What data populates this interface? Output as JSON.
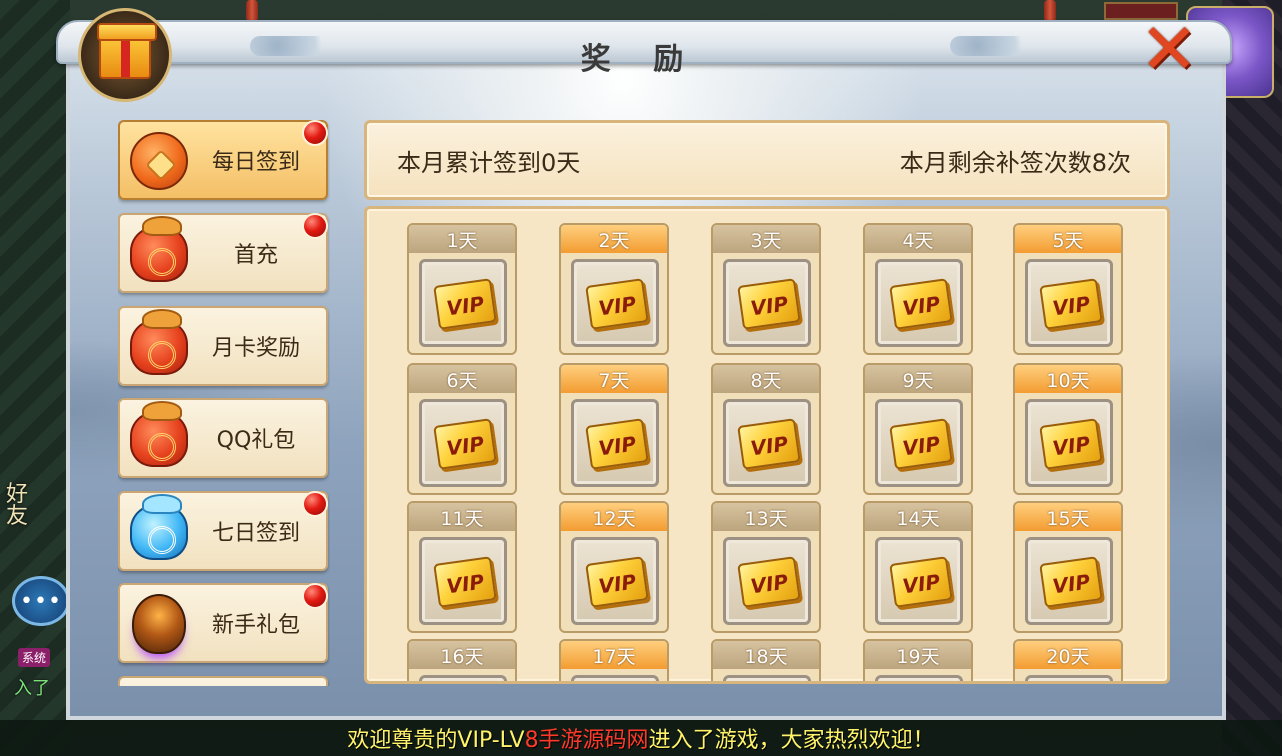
{
  "window": {
    "title": "奖 励",
    "close_symbol": "✕"
  },
  "menu": {
    "items": [
      {
        "label": "每日签到",
        "icon": "pouch-icon",
        "active": true,
        "badge": true
      },
      {
        "label": "首充",
        "icon": "red-bag-icon",
        "active": false,
        "badge": true
      },
      {
        "label": "月卡奖励",
        "icon": "red-bag-icon",
        "active": false,
        "badge": false
      },
      {
        "label": "QQ礼包",
        "icon": "red-bag-icon",
        "active": false,
        "badge": false
      },
      {
        "label": "七日签到",
        "icon": "blue-bag-icon",
        "active": false,
        "badge": true
      },
      {
        "label": "新手礼包",
        "icon": "flame-icon",
        "active": false,
        "badge": true
      }
    ]
  },
  "summary": {
    "signed_days_text": "本月累计签到0天",
    "remaining_makeup_text": "本月剩余补签次数8次"
  },
  "days": [
    {
      "label": "1天",
      "color": "grey"
    },
    {
      "label": "2天",
      "color": "orange"
    },
    {
      "label": "3天",
      "color": "grey"
    },
    {
      "label": "4天",
      "color": "grey"
    },
    {
      "label": "5天",
      "color": "orange"
    },
    {
      "label": "6天",
      "color": "grey"
    },
    {
      "label": "7天",
      "color": "orange"
    },
    {
      "label": "8天",
      "color": "grey"
    },
    {
      "label": "9天",
      "color": "grey"
    },
    {
      "label": "10天",
      "color": "orange"
    },
    {
      "label": "11天",
      "color": "grey"
    },
    {
      "label": "12天",
      "color": "orange"
    },
    {
      "label": "13天",
      "color": "grey"
    },
    {
      "label": "14天",
      "color": "grey"
    },
    {
      "label": "15天",
      "color": "orange"
    },
    {
      "label": "16天",
      "color": "grey"
    },
    {
      "label": "17天",
      "color": "orange"
    },
    {
      "label": "18天",
      "color": "grey"
    },
    {
      "label": "19天",
      "color": "grey"
    },
    {
      "label": "20天",
      "color": "orange"
    }
  ],
  "reward_card_text": "VIP",
  "ticker": {
    "prefix": "欢迎尊贵的VIP-LV",
    "highlight": "8手游源码网",
    "suffix": "进入了游戏，大家热烈欢迎！"
  },
  "side": {
    "friend_label": "好友",
    "system_badge": "系统",
    "system_text": "入了",
    "chat_symbol": "•••"
  },
  "colors": {
    "accent_orange": "#f39c31",
    "badge_red": "#e21a12",
    "ticker_yellow": "#fff36a",
    "ticker_red": "#ff3a2a"
  }
}
